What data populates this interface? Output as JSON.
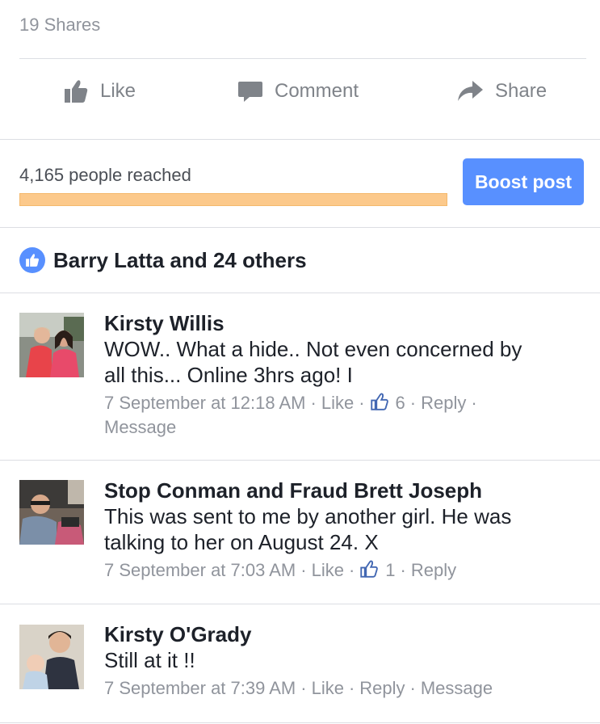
{
  "post": {
    "shares": "19 Shares",
    "actions": {
      "like": "Like",
      "comment": "Comment",
      "share": "Share"
    },
    "reach": {
      "text": "4,165 people reached",
      "fill_fraction": 1.0,
      "boost_label": "Boost post"
    },
    "likes_summary": "Barry Latta and 24 others"
  },
  "comments": [
    {
      "name": "Kirsty Willis",
      "line1": "WOW.. What a hide.. Not even concerned by",
      "line2": "all this... Online 3hrs ago! I",
      "time": "7 September at 12:18 AM",
      "like": "Like",
      "like_count": "6",
      "reply": "Reply",
      "message": "Message"
    },
    {
      "name": "Stop Conman and Fraud Brett Joseph",
      "line1": "This was sent to me by another girl. He was",
      "line2": "talking to her on August 24. X",
      "time": "7 September at 7:03 AM",
      "like": "Like",
      "like_count": "1",
      "reply": "Reply"
    },
    {
      "name": "Kirsty O'Grady",
      "line1": "Still at it !!",
      "time": "7 September at 7:39 AM",
      "like": "Like",
      "reply": "Reply",
      "message": "Message"
    }
  ],
  "colors": {
    "accent": "#5890ff",
    "reach_bar": "#fcc98b",
    "meta_gray": "#90949c"
  },
  "icons": [
    "thumbs-up-icon",
    "comment-bubble-icon",
    "share-arrow-icon",
    "like-badge-icon"
  ]
}
